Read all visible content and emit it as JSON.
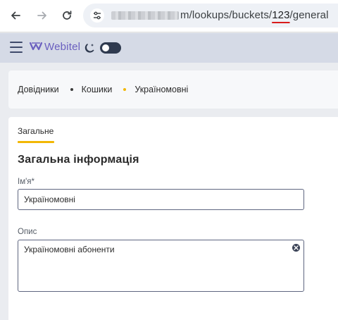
{
  "browser": {
    "url_visible": "m/lookups/buckets/",
    "url_highlight": "123",
    "url_tail": "/general",
    "icons": {
      "back": "arrow-left-icon",
      "forward": "arrow-right-icon",
      "reload": "reload-icon",
      "site": "tune-icon"
    }
  },
  "app": {
    "logo_text": "Webitel",
    "brand_color": "#6a5fbf",
    "menu_icon": "hamburger-menu-icon",
    "theme_icon": "moon-icon"
  },
  "breadcrumbs": [
    {
      "label": "Довідники"
    },
    {
      "label": "Кошики"
    },
    {
      "label": "Україномовні"
    }
  ],
  "breadcrumb_active_color": "#f2b705",
  "tabs": [
    {
      "label": "Загальне",
      "active": true
    }
  ],
  "form": {
    "title": "Загальна інформація",
    "name": {
      "label": "Ім'я*",
      "value": "Україномовні"
    },
    "description": {
      "label": "Опис",
      "value": "Україномовні абоненти"
    }
  }
}
